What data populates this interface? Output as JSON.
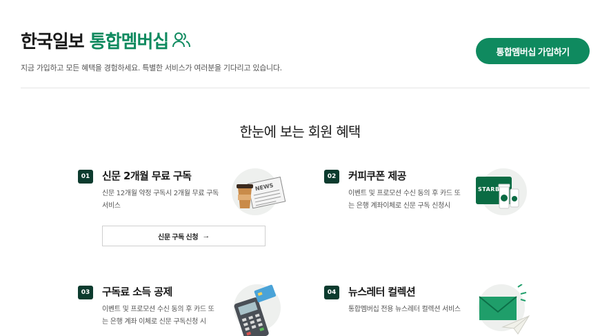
{
  "header": {
    "brand_black": "한국일보",
    "brand_green": "통합멤버십",
    "subtitle": "지금 가입하고 모든 혜택을 경험하세요. 특별한 서비스가 여러분을 기다리고 있습니다.",
    "join_label": "통합멤버십 가입하기",
    "icon": "users-icon"
  },
  "section": {
    "title": "한눈에 보는 회원 혜택"
  },
  "benefits": [
    {
      "num": "01",
      "title": "신문 2개월 무료 구독",
      "desc": "신문 12개월 약정 구독시 2개월 무료 구독 서비스",
      "illustration": "newspaper-coffee-icon",
      "button": "신문 구독 신청"
    },
    {
      "num": "02",
      "title": "커피쿠폰 제공",
      "desc": "이벤트 및 프로모션 수신 동의 후 카드 또는 은행 계좌이체로 신문 구독 신청시",
      "illustration": "starbucks-coupon-icon"
    },
    {
      "num": "03",
      "title": "구독료 소득 공제",
      "desc": "이벤트 및 프로모션 수신 동의 후 카드 또는 은행 계좌 이체로 신문 구독신청 시",
      "illustration": "card-terminal-icon"
    },
    {
      "num": "04",
      "title": "뉴스레터 컬렉션",
      "desc": "통합멤버십 전용 뉴스레터 컬렉션 서비스",
      "illustration": "envelope-paperplane-icon"
    }
  ],
  "colors": {
    "brand_green": "#0f8a5f",
    "badge_dark": "#0c3b2e"
  }
}
